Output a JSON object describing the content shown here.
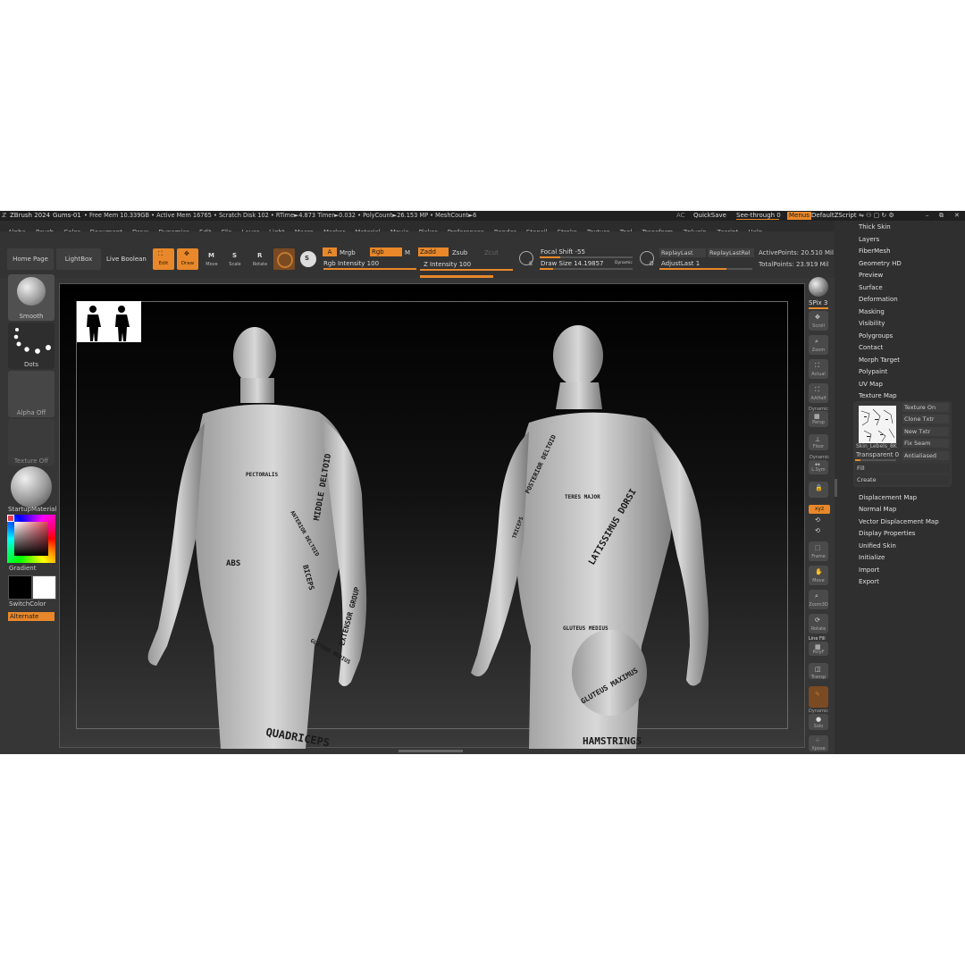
{
  "titlebar": {
    "app": "ZBrush 2024",
    "document": "Gums-01",
    "stats": "• Free Mem 10.339GB • Active Mem 16765 • Scratch Disk 102 • RTime►4.873 Timer►0.032 • PolyCount►26.153 MP • MeshCount►6",
    "ac": "AC",
    "quicksave": "QuickSave",
    "see_through": "See-through  0",
    "menus": "Menus",
    "default_zscript": "DefaultZScript"
  },
  "menubar": [
    "Alpha",
    "Brush",
    "Color",
    "Document",
    "Draw",
    "Dynamics",
    "Edit",
    "File",
    "Layer",
    "Light",
    "Macro",
    "Marker",
    "Material",
    "Movie",
    "Picker",
    "Preferences",
    "Render",
    "Stencil",
    "Stroke",
    "Texture",
    "Tool",
    "Transform",
    "Zplugin",
    "Zscript",
    "Help"
  ],
  "toolbar": {
    "home_page": "Home Page",
    "lightbox": "LightBox",
    "live_boolean": "Live Boolean",
    "edit": "Edit",
    "draw": "Draw",
    "move": "Move",
    "scale": "Scale",
    "rotate": "Rotate",
    "a": "A",
    "mrgb": "Mrgb",
    "rgb": "Rgb",
    "m": "M",
    "rgb_intensity": "Rgb Intensity 100",
    "zadd": "Zadd",
    "zsub": "Zsub",
    "zcut": "Zcut",
    "z_intensity": "Z Intensity 100",
    "focal_shift": "Focal Shift -55",
    "draw_size": "Draw Size 14.19857",
    "dynamic": "Dynamic",
    "replay_last": "ReplayLast",
    "replay_last_rel": "ReplayLastRel",
    "adjust_last": "AdjustLast 1",
    "active_points": "ActivePoints: 20.510 Mil",
    "total_points": "TotalPoints: 23.919 Mil"
  },
  "left_panel": {
    "brush": "Smooth",
    "stroke": "Dots",
    "alpha": "Alpha Off",
    "texture": "Texture Off",
    "material": "StartupMaterial",
    "gradient": "Gradient",
    "switch_color": "SwitchColor",
    "alternate": "Alternate"
  },
  "right_shelf": [
    "BPR",
    "SPix 3",
    "Scroll",
    "Zoom",
    "Actual",
    "AAHalf",
    "Persp",
    "Floor",
    "L.Sym",
    "Frame",
    "Move",
    "Zoom3D",
    "Rotate",
    "PolyF",
    "Transp",
    "Dynamic",
    "Solo",
    "Xpose"
  ],
  "right_shelf_labels": {
    "dynamic_top": "Dynamic",
    "dynamic2": "Dynamic",
    "line_fill": "Line Fill"
  },
  "tool_menu": {
    "items_top": [
      "Thick Skin",
      "Layers",
      "FiberMesh",
      "Geometry HD",
      "Preview",
      "Surface",
      "Deformation",
      "Masking",
      "Visibility",
      "Polygroups",
      "Contact",
      "Morph Target",
      "Polypaint",
      "UV Map",
      "Texture Map"
    ],
    "texture_map": {
      "texture_on": "Texture On",
      "clone_txtr": "Clone Txtr",
      "new_txtr": "New Txtr",
      "fix_seam": "Fix Seam",
      "antialiased": "Antialiased",
      "texture_name": "Skin_Lebels_8K",
      "transparent": "Transparent 0",
      "fill": "Fill",
      "create": "Create"
    },
    "items_bottom": [
      "Displacement Map",
      "Normal Map",
      "Vector Displacement Map",
      "Display Properties",
      "Unified Skin",
      "Initialize",
      "Import",
      "Export"
    ]
  },
  "canvas_labels": {
    "front_figure": [
      "MIDDLE DELTOID",
      "ANTERIOR DELTOID",
      "PECTORALIS",
      "BICEPS",
      "EXTENSOR GROUP",
      "GLUTEUS MEDIUS",
      "QUADRICEPS",
      "ABS"
    ],
    "back_figure": [
      "POSTERIOR DELTOID",
      "TERES MAJOR",
      "LATISSIMUS DORSI",
      "GLUTEUS MEDIUS",
      "GLUTEUS MAXIMUS",
      "HAMSTRINGS",
      "TRICEPS"
    ]
  },
  "colors": {
    "accent": "#e8882a",
    "panel": "#363636",
    "canvas_top": "#000000",
    "canvas_bottom": "#3a3a3a"
  }
}
